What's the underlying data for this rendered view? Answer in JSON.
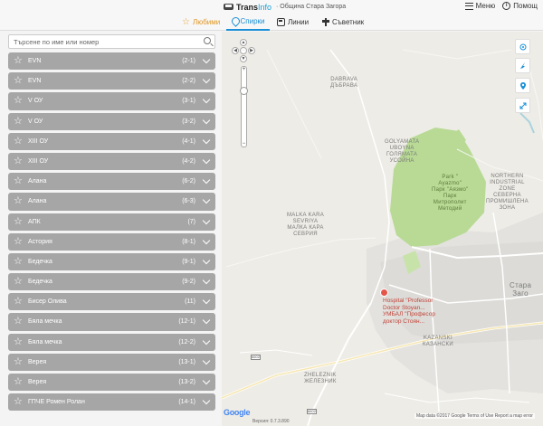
{
  "app": {
    "brand_a": "Trans",
    "brand_b": "Info",
    "subtitle": "· Община Стара Загора"
  },
  "header": {
    "menu_label": "Меню",
    "help_label": "Помощ"
  },
  "tabs": {
    "favorites": "Любими",
    "stops": "Спирки",
    "lines": "Линии",
    "advisor": "Съветник"
  },
  "search": {
    "placeholder": "Търсене по име или номер"
  },
  "stops": [
    {
      "name": "EVN",
      "code": "(2-1)"
    },
    {
      "name": "EVN",
      "code": "(2-2)"
    },
    {
      "name": "V ОУ",
      "code": "(3-1)"
    },
    {
      "name": "V ОУ",
      "code": "(3-2)"
    },
    {
      "name": "XIII ОУ",
      "code": "(4-1)"
    },
    {
      "name": "XIII ОУ",
      "code": "(4-2)"
    },
    {
      "name": "Алана",
      "code": "(6-2)"
    },
    {
      "name": "Алана",
      "code": "(6-3)"
    },
    {
      "name": "АПК",
      "code": "(7)"
    },
    {
      "name": "Астория",
      "code": "(8-1)"
    },
    {
      "name": "Бедечка",
      "code": "(9-1)"
    },
    {
      "name": "Бедечка",
      "code": "(9-2)"
    },
    {
      "name": "Бисер Олива",
      "code": "(11)"
    },
    {
      "name": "Бяла мечка",
      "code": "(12-1)"
    },
    {
      "name": "Бяла мечка",
      "code": "(12-2)"
    },
    {
      "name": "Верея",
      "code": "(13-1)"
    },
    {
      "name": "Верея",
      "code": "(13-2)"
    },
    {
      "name": "ГПЧЕ Ромен Ролан",
      "code": "(14-1)"
    }
  ],
  "map": {
    "labels": {
      "dabrava": "DABRAVA\nДЪБРАВА",
      "golyamata": "GOLYAMATA\nUBOYNA\nГОЛЯМАТА\nУСОЙНА",
      "park": "Park \"\nAyazmo\"\nПарк \"Аязмо\"\nПарк\nМитрополит\nМетодий",
      "northern": "NORTHERN\nINDUSTRIAL\nZONE\nСЕВЕРНА\nПРОМИШЛЕНА\nЗОНА",
      "malka": "MALKA KARA\nSEVRIYA\nМАЛКА КАРА\nСЕВРИЯ",
      "stara": "Стара\nЗаго",
      "kazanski": "KAZANSKI\nКАЗАНСКИ",
      "zheleznik": "ZHELEZNIK\nЖЕЛЕЗНИК",
      "hospital": "Hospital \"Professor\nDoctor Stoyan...\nУМБАЛ \"Професор\nдоктор Стоян..."
    },
    "road_badges": [
      "6602",
      "6602"
    ],
    "google": "Google",
    "version": "Версия: 0.7.3.890",
    "footer": "Map data ©2017 Google    Terms of Use    Report a map error"
  },
  "colors": {
    "accent": "#1a8fd6",
    "favorite": "#e09620",
    "row_bg": "#a6a6a6",
    "park": "#b8da95",
    "hospital": "#e4554a"
  }
}
